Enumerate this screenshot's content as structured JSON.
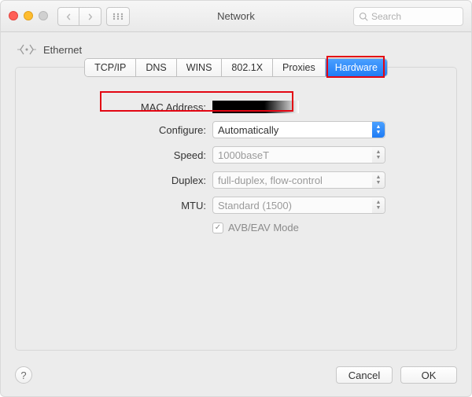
{
  "window": {
    "title": "Network",
    "search_placeholder": "Search"
  },
  "breadcrumb": {
    "label": "Ethernet"
  },
  "tabs": [
    {
      "label": "TCP/IP",
      "active": false
    },
    {
      "label": "DNS",
      "active": false
    },
    {
      "label": "WINS",
      "active": false
    },
    {
      "label": "802.1X",
      "active": false
    },
    {
      "label": "Proxies",
      "active": false
    },
    {
      "label": "Hardware",
      "active": true
    }
  ],
  "form": {
    "mac_label": "MAC Address:",
    "mac_value_redacted": true,
    "configure_label": "Configure:",
    "configure_value": "Automatically",
    "speed_label": "Speed:",
    "speed_value": "1000baseT",
    "duplex_label": "Duplex:",
    "duplex_value": "full-duplex, flow-control",
    "mtu_label": "MTU:",
    "mtu_value": "Standard  (1500)",
    "avb_label": "AVB/EAV Mode",
    "avb_checked": true
  },
  "footer": {
    "help_label": "?",
    "cancel_label": "Cancel",
    "ok_label": "OK"
  }
}
